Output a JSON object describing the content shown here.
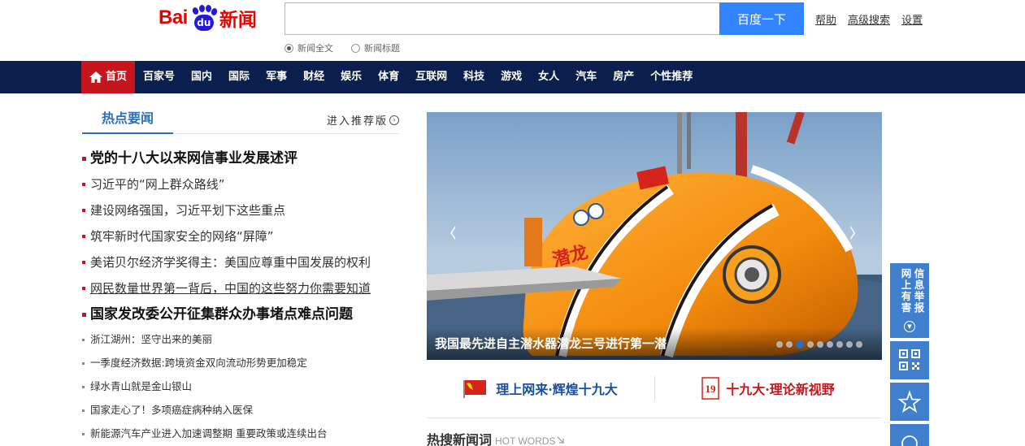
{
  "header": {
    "logo_bai": "Bai",
    "logo_du": "du",
    "logo_news": "新闻",
    "search_value": "",
    "search_button": "百度一下",
    "links": [
      "帮助",
      "高级搜索",
      "设置"
    ],
    "radio_options": [
      {
        "label": "新闻全文",
        "selected": true
      },
      {
        "label": "新闻标题",
        "selected": false
      }
    ]
  },
  "nav": {
    "items": [
      "首页",
      "百家号",
      "国内",
      "国际",
      "军事",
      "财经",
      "娱乐",
      "体育",
      "互联网",
      "科技",
      "游戏",
      "女人",
      "汽车",
      "房产",
      "个性推荐"
    ],
    "active_index": 0
  },
  "hot": {
    "title": "热点要闻",
    "more": "进入推荐版",
    "items": [
      {
        "text": "党的十八大以来网信事业发展述评",
        "style": "big"
      },
      {
        "text": "习近平的“网上群众路线”",
        "style": "mid"
      },
      {
        "text": "建设网络强国，习近平划下这些重点",
        "style": "mid"
      },
      {
        "text": "筑牢新时代国家安全的网络“屏障”",
        "style": "mid"
      },
      {
        "text": "美诺贝尔经济学奖得主：美国应尊重中国发展的权利",
        "style": "mid"
      },
      {
        "text": "网民数量世界第一背后，中国的这些努力你需要知道",
        "style": "mid"
      },
      {
        "text": "国家发改委公开征集群众办事堵点难点问题",
        "style": "big"
      },
      {
        "text": "浙江湖州：坚守出来的美丽",
        "style": "small"
      },
      {
        "text": "一季度经济数据:跨境资金双向流动形势更加稳定",
        "style": "small"
      },
      {
        "text": "绿水青山就是金山银山",
        "style": "small"
      },
      {
        "text": "国家走心了！多项癌症病种纳入医保",
        "style": "small"
      },
      {
        "text": "新能源汽车产业进入加速调整期 重要政策或连续出台",
        "style": "small"
      }
    ]
  },
  "carousel": {
    "caption": "我国最先进自主潜水器潜龙三号进行第一潜",
    "prev": "‹",
    "next": "›",
    "slide_count": 9,
    "active_slide": 3,
    "vessel_label": "潜龙"
  },
  "banners": [
    {
      "text": "理上网来·辉煌十九大",
      "color": "#1a4fa8",
      "icon": "party-flag-icon"
    },
    {
      "text": "十九大·理论新视野",
      "color": "#c4161c",
      "icon": "nineteen-icon"
    }
  ],
  "hot_words": {
    "title": "热搜新闻词",
    "subtitle": "HOT WORDS"
  },
  "side": {
    "report_text": "网上有害信息举报"
  },
  "colors": {
    "nav_bg": "#0a1f4d",
    "nav_active": "#c4161c",
    "accent_blue": "#3385ff",
    "side_blue": "#3f7fce"
  }
}
